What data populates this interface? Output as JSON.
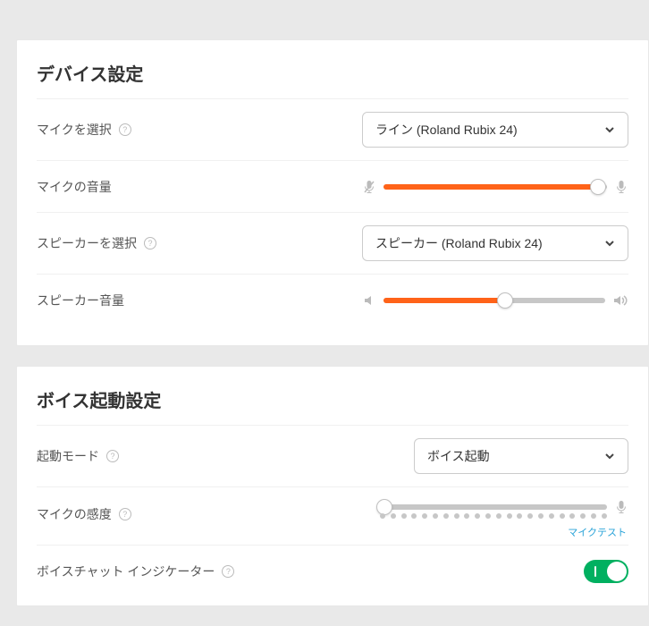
{
  "device": {
    "title": "デバイス設定",
    "mic_select_label": "マイクを選択",
    "mic_select_value": "ライン (Roland Rubix 24)",
    "mic_volume_label": "マイクの音量",
    "mic_volume_percent": 96,
    "speaker_select_label": "スピーカーを選択",
    "speaker_select_value": "スピーカー (Roland Rubix 24)",
    "speaker_volume_label": "スピーカー音量",
    "speaker_volume_percent": 55
  },
  "voice": {
    "title": "ボイス起動設定",
    "mode_label": "起動モード",
    "mode_value": "ボイス起動",
    "sensitivity_label": "マイクの感度",
    "sensitivity_percent": 2,
    "mic_test": "マイクテスト",
    "indicator_label": "ボイスチャット インジケーター",
    "indicator_on": true
  }
}
